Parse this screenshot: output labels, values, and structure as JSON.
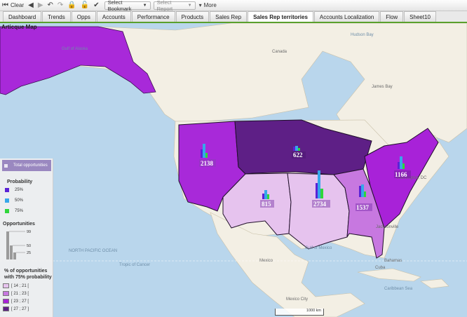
{
  "toolbar": {
    "clear_label": "Clear",
    "bookmark_label": "Select Bookmark",
    "report_label": "Select Report",
    "more_label": "More"
  },
  "tabs": [
    {
      "label": "Dashboard"
    },
    {
      "label": "Trends"
    },
    {
      "label": "Opps"
    },
    {
      "label": "Accounts"
    },
    {
      "label": "Performance"
    },
    {
      "label": "Products"
    },
    {
      "label": "Sales Rep"
    },
    {
      "label": "Sales Rep territories",
      "active": true
    },
    {
      "label": "Accounts Localization"
    },
    {
      "label": "Flow"
    },
    {
      "label": "Sheet10"
    }
  ],
  "map": {
    "title": "Articque Map",
    "scale_label": "1000 km",
    "ocean_labels": [
      "Gulf of Alaska",
      "Hudson Bay",
      "Gulf of Mexico",
      "NORTH PACIFIC OCEAN",
      "Tropic of Cancer",
      "Caribbean Sea"
    ],
    "land_labels": [
      "Canada",
      "James Bay",
      "Mexico",
      "Cuba",
      "Bahamas",
      "Washington, DC",
      "Jacksonville",
      "Mexico City"
    ],
    "territories": [
      {
        "value": "2138"
      },
      {
        "value": "622"
      },
      {
        "value": "1166"
      },
      {
        "value": "815"
      },
      {
        "value": "2734"
      },
      {
        "value": "1537"
      }
    ]
  },
  "legend": {
    "total_label": "Total opportunities",
    "probability_title": "Probability",
    "probability_items": [
      {
        "label": "25%",
        "color": "#5b22d6"
      },
      {
        "label": "50%",
        "color": "#36a7ea"
      },
      {
        "label": "75%",
        "color": "#2fd63b"
      }
    ],
    "opportunities_title": "Opportunities",
    "opp_ticks": [
      "99",
      "50",
      "25"
    ],
    "pct_title_line1": "% of opportunities",
    "pct_title_line2": "with 75% probability",
    "classes": [
      {
        "label": "[ 14 ; 21 [",
        "color": "#e6c3ee"
      },
      {
        "label": "[ 21 ; 23 [",
        "color": "#c778e0"
      },
      {
        "label": "[ 23 ; 27 [",
        "color": "#a822d8"
      },
      {
        "label": "[ 27 ; 27 ]",
        "color": "#5e1f86"
      }
    ]
  }
}
